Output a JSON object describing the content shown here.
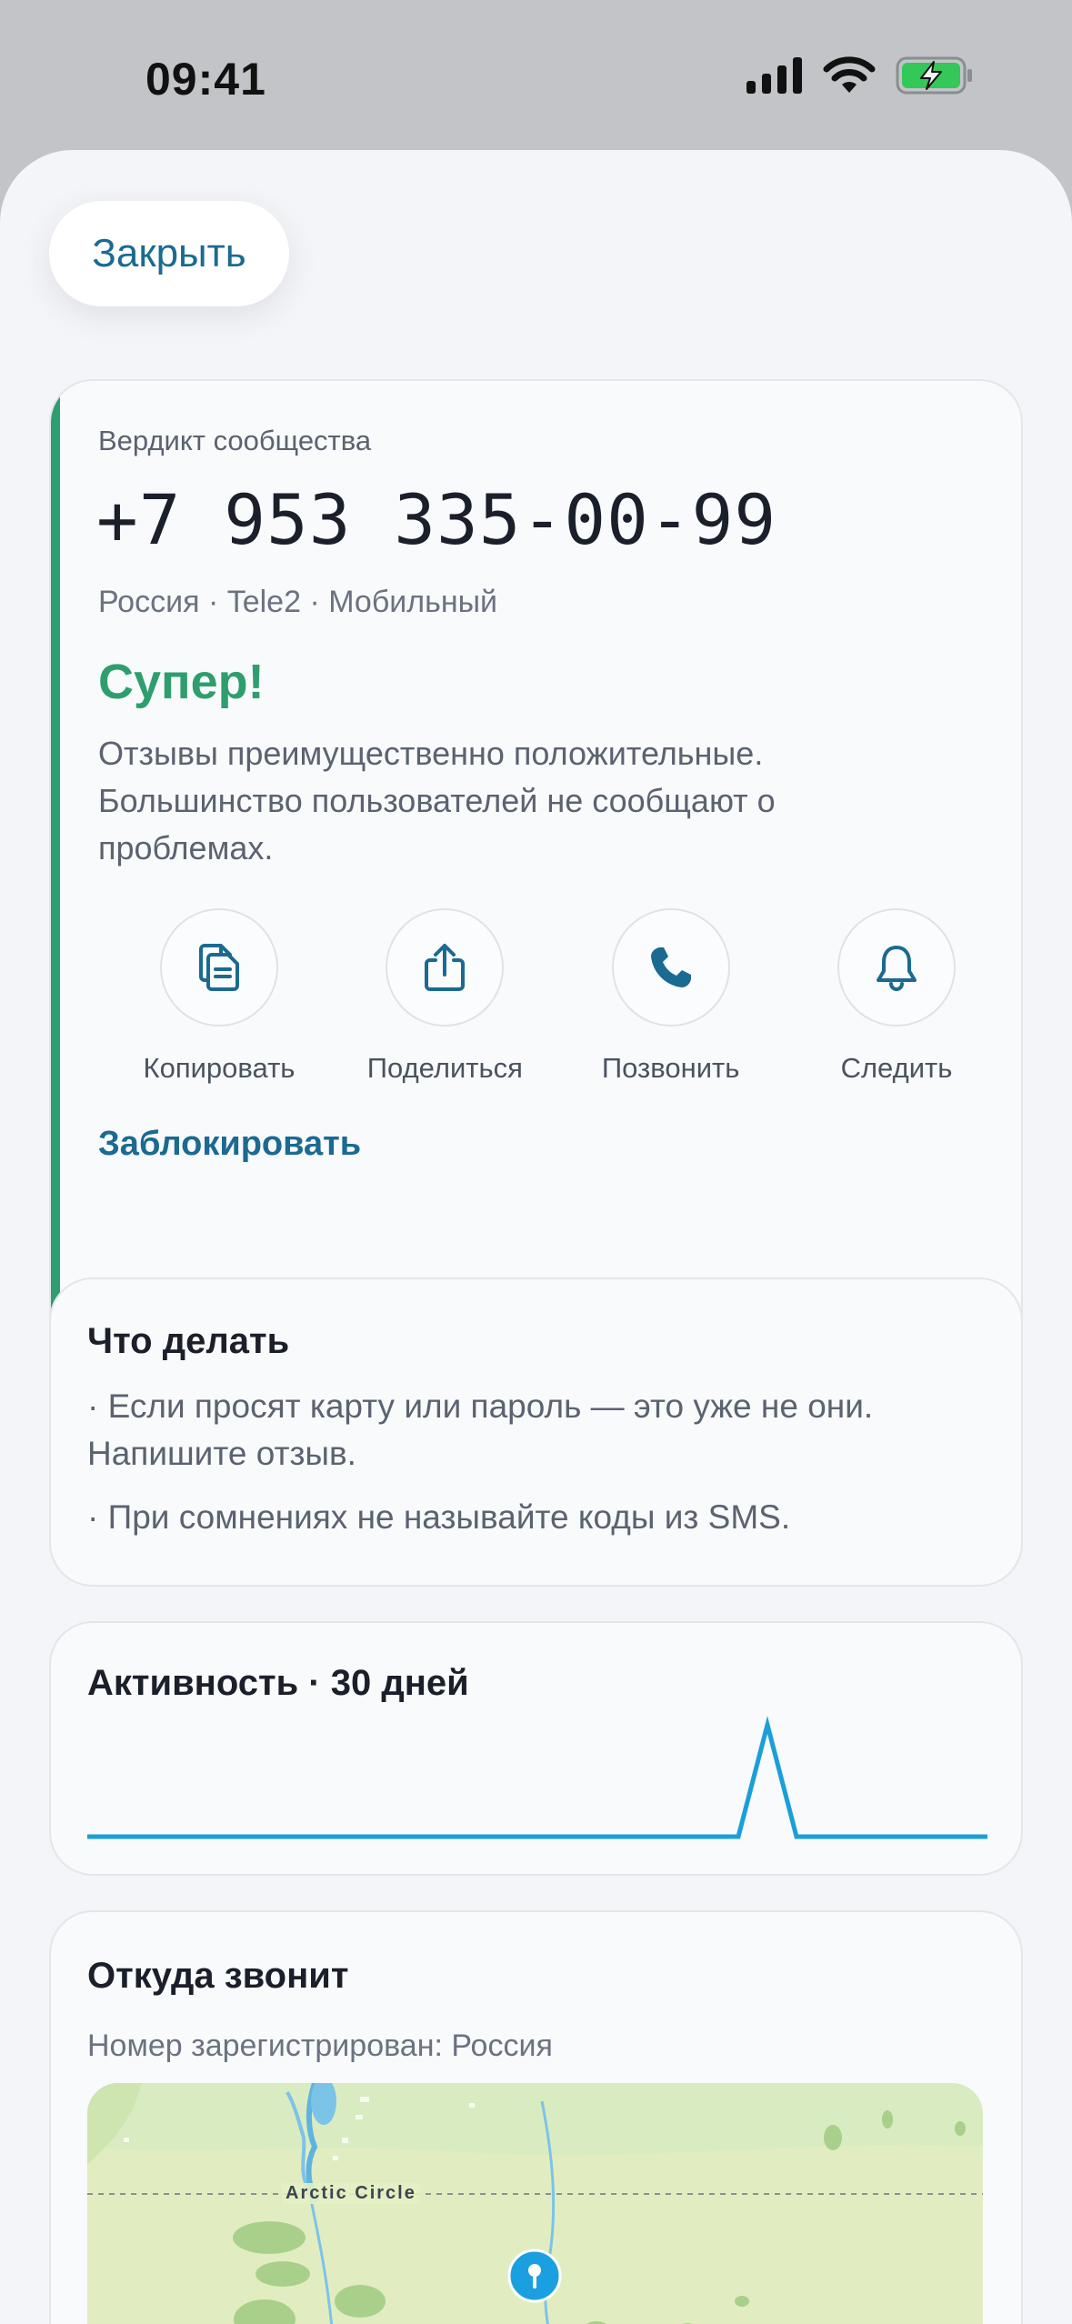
{
  "status_bar": {
    "time": "09:41"
  },
  "header": {
    "close_label": "Закрыть"
  },
  "verdict": {
    "caption": "Вердикт сообщества",
    "phone": "+7 953 335-00-99",
    "meta": "Россия · Tele2 · Мобильный",
    "title": "Супер!",
    "description": "Отзывы преимущественно положительные. Большинство пользователей не сообщают о проблемах.",
    "accent_color": "#2f9e6e",
    "actions": [
      {
        "label": "Копировать",
        "icon": "copy-icon"
      },
      {
        "label": "Поделиться",
        "icon": "share-icon"
      },
      {
        "label": "Позвонить",
        "icon": "phone-icon"
      },
      {
        "label": "Следить",
        "icon": "bell-icon"
      }
    ],
    "block_label": "Заблокировать"
  },
  "todo": {
    "title": "Что делать",
    "items": [
      "· Если просят карту или пароль — это уже не они. Напишите отзыв.",
      "· При сомнениях не называйте коды из SMS."
    ]
  },
  "activity": {
    "title": "Активность · 30 дней",
    "line_color": "#1a9fd8"
  },
  "where": {
    "title": "Откуда звонит",
    "subtitle": "Номер зарегистрирован: Россия",
    "map_label": "Arctic Circle"
  }
}
